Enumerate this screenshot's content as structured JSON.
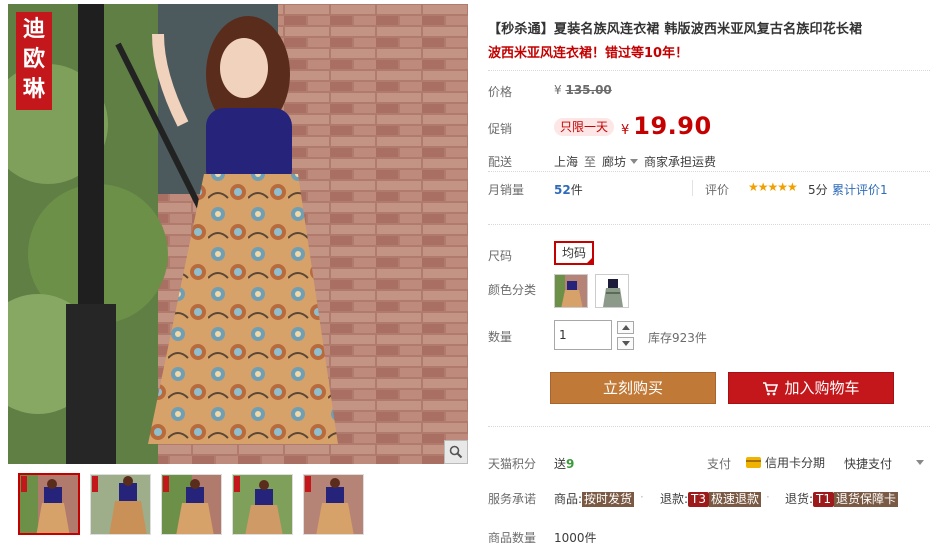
{
  "gallery": {
    "brand_seal": [
      "迪",
      "欧",
      "琳"
    ],
    "zoom_icon": "magnifier-icon",
    "thumbnail_count": 5
  },
  "product": {
    "title": "【秒杀通】夏装名族风连衣裙 韩版波西米亚风复古名族印花长裙",
    "subtitle": "波西米亚风连衣裙！错过等10年！"
  },
  "price": {
    "label": "价格",
    "currency": "¥",
    "original": "135.00"
  },
  "promo": {
    "label": "促销",
    "badge": "只限一天",
    "currency": "¥",
    "price": "19.90"
  },
  "shipping": {
    "label": "配送",
    "from": "上海",
    "to_word": "至",
    "destination": "廊坊",
    "fee_note": "商家承担运费"
  },
  "sales": {
    "label": "月销量",
    "count": "52",
    "unit": "件"
  },
  "rating": {
    "label": "评价",
    "stars": "★★★★★",
    "score": "5分",
    "review_link": "累计评价1"
  },
  "size": {
    "label": "尺码",
    "selected": "均码"
  },
  "color": {
    "label": "颜色分类",
    "option_count": 2
  },
  "quantity": {
    "label": "数量",
    "value": "1",
    "stock": "库存923件"
  },
  "actions": {
    "buy_now": "立刻购买",
    "add_to_cart": "加入购物车"
  },
  "points": {
    "label": "天猫积分",
    "prefix": "送",
    "value": "9"
  },
  "payment": {
    "label": "支付",
    "credit": "信用卡分期",
    "quick": "快捷支付"
  },
  "services": {
    "label": "服务承诺",
    "goods_prefix": "商品:",
    "goods_tag": "按时发货",
    "refund_prefix": "退款:",
    "refund_code": "T3",
    "refund_tag": "极速退款",
    "return_prefix": "退货:",
    "return_code": "T1",
    "return_tag": "退货保障卡"
  },
  "stock_total": {
    "label": "商品数量",
    "value": "1000件"
  },
  "colors": {
    "accent_red": "#c40000",
    "buy_orange": "#c07937",
    "cart_red": "#c4171b",
    "link_blue": "#2e6bb8",
    "star_gold": "#f0a000"
  }
}
